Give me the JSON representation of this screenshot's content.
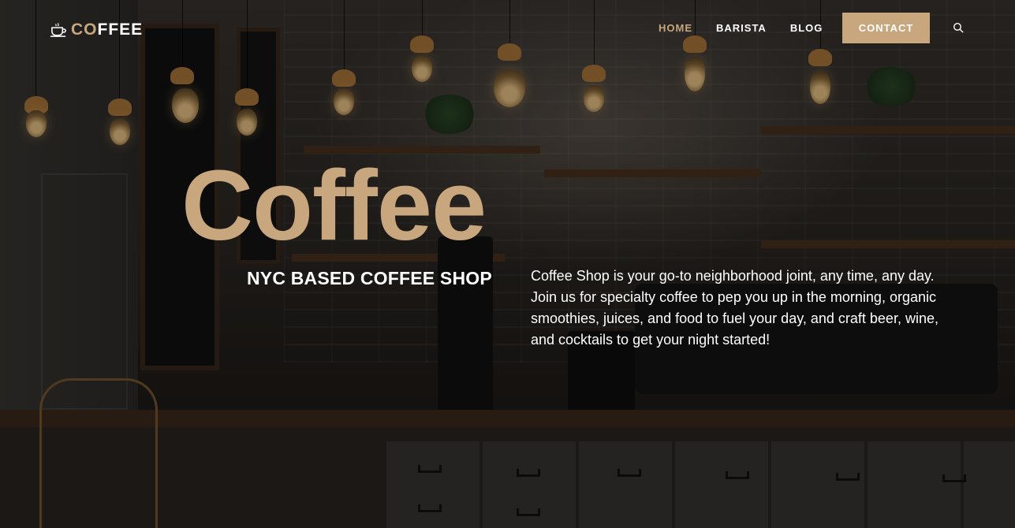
{
  "brand": {
    "logo_prefix": "CO",
    "logo_suffix": "FFEE",
    "accent_color": "#c8a67e",
    "logo_icon": "coffee-cup-icon"
  },
  "nav": {
    "items": [
      {
        "label": "HOME",
        "active": true
      },
      {
        "label": "BARISTA",
        "active": false
      },
      {
        "label": "BLOG",
        "active": false
      }
    ],
    "contact_label": "CONTACT",
    "search_icon": "search-icon"
  },
  "hero": {
    "title": "Coffee",
    "subtitle": "NYC BASED COFFEE SHOP",
    "description": "Coffee Shop is your go-to neighborhood joint, any time, any day. Join us for specialty coffee to pep you up in the morning, organic smoothies, juices, and food to fuel your day, and craft beer, wine, and cocktails to get your night started!"
  }
}
